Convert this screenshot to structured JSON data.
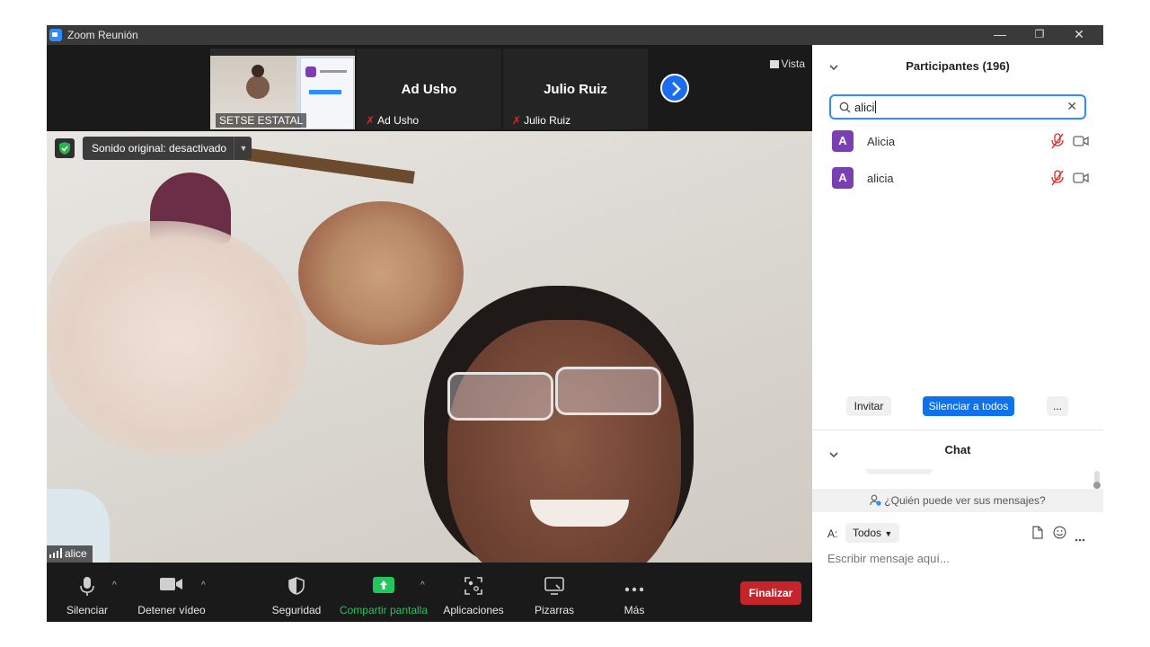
{
  "window": {
    "title": "Zoom Reunión",
    "minimize": "—",
    "restore": "❐",
    "close": "✕"
  },
  "strip": {
    "thumbs": [
      {
        "label": "SETSE ESTATAL"
      },
      {
        "big": "Ad Usho",
        "label": "Ad Usho"
      },
      {
        "big": "Julio Ruiz",
        "label": "Julio Ruiz"
      }
    ],
    "view_label": "Vista"
  },
  "video": {
    "sound_label": "Sonido original: desactivado",
    "speaker_name": "alice"
  },
  "toolbar": {
    "mute": "Silenciar",
    "video": "Detener vídeo",
    "security": "Seguridad",
    "share": "Compartir pantalla",
    "apps": "Aplicaciones",
    "whiteboards": "Pizarras",
    "more": "Más",
    "end": "Finalizar"
  },
  "participants": {
    "title": "Participantes (196)",
    "search_value": "alici",
    "list": [
      {
        "initial": "A",
        "name": "Alicia"
      },
      {
        "initial": "A",
        "name": "alicia"
      }
    ],
    "invite": "Invitar",
    "mute_all": "Silenciar a todos",
    "more": "..."
  },
  "chat": {
    "title": "Chat",
    "who_can_see": "¿Quién puede ver sus mensajes?",
    "to_label": "A:",
    "recipient": "Todos",
    "placeholder": "Escribir mensaje aquí..."
  },
  "colors": {
    "accent": "#2d8cff",
    "end": "#c5252a",
    "share": "#22c55e",
    "avatar": "#7b3fb4",
    "mute_red": "#e02828"
  }
}
